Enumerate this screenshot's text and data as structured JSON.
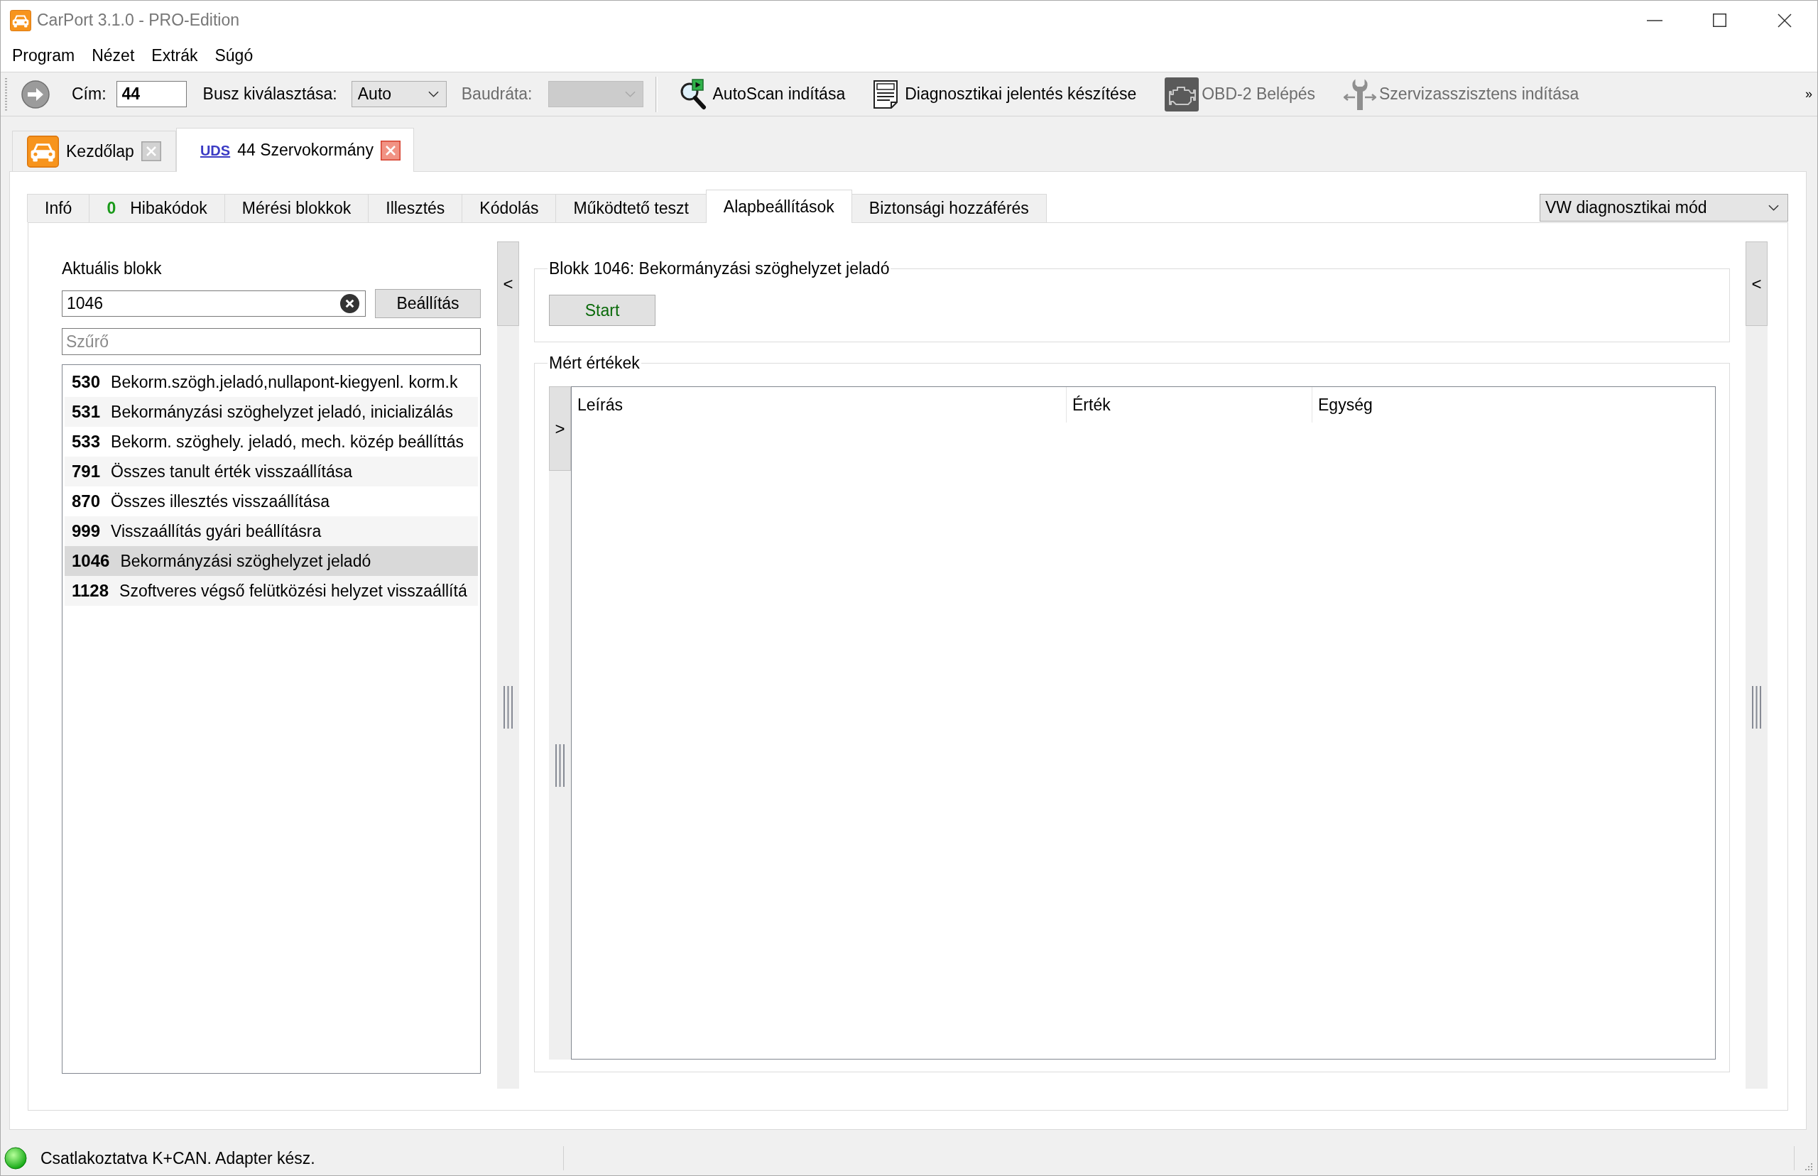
{
  "window": {
    "title": "CarPort 3.1.0 - PRO-Edition"
  },
  "menu": [
    {
      "label": "Program"
    },
    {
      "label": "Nézet"
    },
    {
      "label": "Extrák"
    },
    {
      "label": "Súgó"
    }
  ],
  "toolbar": {
    "address": {
      "label": "Cím:",
      "value": "44"
    },
    "bus": {
      "label": "Busz kiválasztása:",
      "value": "Auto"
    },
    "baud_rate": {
      "label": "Baudráta:",
      "disabled": true
    },
    "actions": [
      {
        "kind": "autoscan",
        "label": "AutoScan indítása",
        "disabled": false
      },
      {
        "kind": "report",
        "label": "Diagnosztikai jelentés készítése",
        "disabled": false
      },
      {
        "kind": "obd",
        "label": "OBD-2 Belépés",
        "disabled": true
      },
      {
        "kind": "service",
        "label": "Szervizasszisztens indítása",
        "disabled": true
      }
    ],
    "overflow": "»"
  },
  "document_tabs": [
    {
      "kind": "home",
      "label": "Kezdőlap",
      "selected": false
    },
    {
      "kind": "module",
      "badge": "UDS",
      "label": "44 Szervokormány",
      "selected": true
    }
  ],
  "module_tabs": [
    {
      "label": "Infó",
      "selected": false
    },
    {
      "count": "0",
      "label": "Hibakódok",
      "selected": false
    },
    {
      "label": "Mérési blokkok",
      "selected": false
    },
    {
      "label": "Illesztés",
      "selected": false
    },
    {
      "label": "Kódolás",
      "selected": false
    },
    {
      "label": "Működtető teszt",
      "selected": false
    },
    {
      "label": "Alapbeállítások",
      "selected": true
    },
    {
      "label": "Biztonsági hozzáférés",
      "selected": false
    }
  ],
  "mode_select": {
    "value": "VW diagnosztikai mód"
  },
  "block_panel": {
    "label": "Aktuális blokk",
    "value": "1046",
    "apply_button": "Beállítás",
    "filter": {
      "placeholder": "Szűrő"
    },
    "items": [
      {
        "number": "530",
        "text": "Bekorm.szögh.jeladó,nullapont-kiegyenl. korm.k",
        "selected": false
      },
      {
        "number": "531",
        "text": "Bekormányzási szöghelyzet jeladó, inicializálás",
        "selected": false
      },
      {
        "number": "533",
        "text": "Bekorm. szöghely. jeladó, mech. közép beállíttás",
        "selected": false
      },
      {
        "number": "791",
        "text": "Összes tanult érték visszaállítása",
        "selected": false
      },
      {
        "number": "870",
        "text": "Összes illesztés visszaállítása",
        "selected": false
      },
      {
        "number": "999",
        "text": "Visszaállítás gyári beállításra",
        "selected": false
      },
      {
        "number": "1046",
        "text": "Bekormányzási szöghelyzet jeladó",
        "selected": true
      },
      {
        "number": "1128",
        "text": "Szoftveres végső felütközési helyzet visszaállítá",
        "selected": false
      }
    ]
  },
  "left_splitter": {
    "button": "<"
  },
  "block_group": {
    "title": "Blokk 1046: Bekormányzási szöghelyzet jeladó",
    "start_button": "Start"
  },
  "values_group": {
    "title": "Mért értékek",
    "expand_button": ">",
    "table": {
      "columns": [
        "Leírás",
        "Érték",
        "Egység"
      ]
    }
  },
  "right_splitter": {
    "button": "<"
  },
  "status_bar": {
    "connected": true,
    "text": "Csatlakoztatva K+CAN. Adapter kész."
  }
}
